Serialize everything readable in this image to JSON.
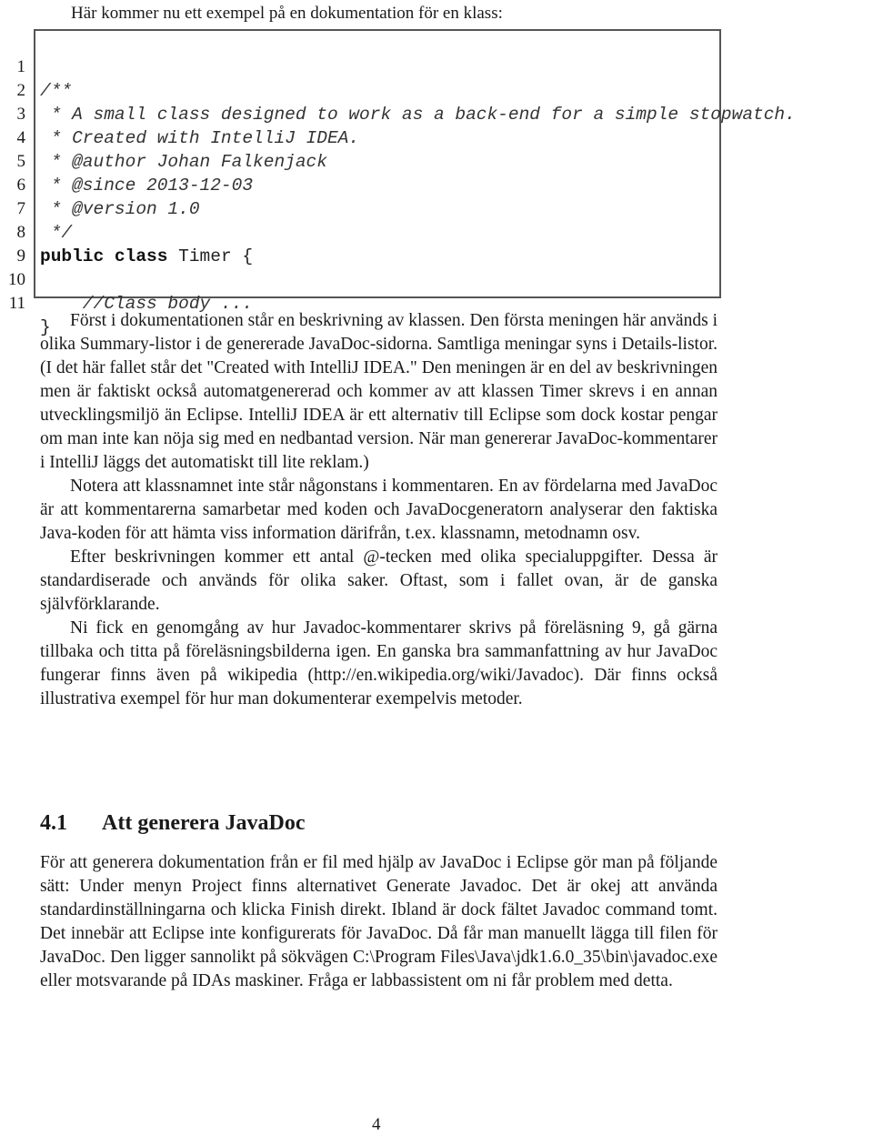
{
  "intro": "Här kommer nu ett exempel på en dokumentation för en klass:",
  "code_listing": {
    "lines": [
      {
        "no": "1",
        "text": "/**",
        "style": "comment"
      },
      {
        "no": "2",
        "text": " * A small class designed to work as a back-end for a simple stopwatch.",
        "style": "comment"
      },
      {
        "no": "3",
        "text": " * Created with IntelliJ IDEA.",
        "style": "comment"
      },
      {
        "no": "4",
        "text": " * @author Johan Falkenjack",
        "style": "comment"
      },
      {
        "no": "5",
        "text": " * @since 2013-12-03",
        "style": "comment"
      },
      {
        "no": "6",
        "text": " * @version 1.0",
        "style": "comment"
      },
      {
        "no": "7",
        "text": " */",
        "style": "comment"
      },
      {
        "no": "8",
        "keyword": "public class",
        "text": " Timer {",
        "style": "keyword"
      },
      {
        "no": "9",
        "text": "",
        "style": "plain"
      },
      {
        "no": "10",
        "text": "    //Class body ...",
        "style": "comment"
      },
      {
        "no": "11",
        "text": "}",
        "style": "plain"
      }
    ]
  },
  "paragraphs": [
    "Först i dokumentationen står en beskrivning av klassen. Den första meningen här används i olika Summary-listor i de genererade JavaDoc-sidorna. Samtliga meningar syns i Details-listor. (I det här fallet står det \"Created with IntelliJ IDEA.\" Den meningen är en del av beskrivningen men är faktiskt också automatgenererad och kommer av att klassen Timer skrevs i en annan utvecklingsmiljö än Eclipse. IntelliJ IDEA är ett alternativ till Eclipse som dock kostar pengar om man inte kan nöja sig med en nedbantad version. När man genererar JavaDoc-kommentarer i IntelliJ läggs det automatiskt till lite reklam.)",
    "Notera att klassnamnet inte står någonstans i kommentaren. En av fördelarna med JavaDoc är att kommentarerna samarbetar med koden och JavaDocgeneratorn analyserar den faktiska Java-koden för att hämta viss information därifrån, t.ex. klassnamn, metodnamn osv.",
    "Efter beskrivningen kommer ett antal @-tecken med olika specialuppgifter. Dessa är standardiserade och används för olika saker. Oftast, som i fallet ovan, är de ganska självförklarande.",
    "Ni fick en genomgång av hur Javadoc-kommentarer skrivs på föreläsning 9, gå gärna tillbaka och titta på föreläsningsbilderna igen. En ganska bra sammanfattning av hur JavaDoc fungerar finns även på wikipedia (http://en.wikipedia.org/wiki/Javadoc). Där finns också illustrativa exempel för hur man dokumenterar exempelvis metoder."
  ],
  "section": {
    "number": "4.1",
    "title": "Att generera JavaDoc",
    "text": "För att generera dokumentation från er fil med hjälp av JavaDoc i Eclipse gör man på följande sätt: Under menyn Project finns alternativet Generate Javadoc. Det är okej att använda standardinställningarna och klicka Finish direkt. Ibland är dock fältet Javadoc command tomt. Det innebär att Eclipse inte konfigurerats för JavaDoc. Då får man manuellt lägga till filen för JavaDoc. Den ligger sannolikt på sökvägen C:\\Program Files\\Java\\jdk1.6.0_35\\bin\\javadoc.exe eller motsvarande på IDAs maskiner. Fråga er labbassistent om ni får problem med detta."
  },
  "page_number": "4"
}
